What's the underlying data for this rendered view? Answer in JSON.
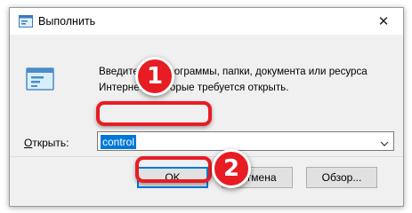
{
  "window": {
    "title": "Выполнить",
    "close_symbol": "✕",
    "app_icon": "run-dialog-icon"
  },
  "dialog": {
    "icon": "run-program-icon",
    "description_line1": "Введите имя программы, папки, документа или ресурса",
    "description_line2": "Интернета, которые требуется открыть.",
    "open_label_prefix": "О",
    "open_label_rest": "ткрыть:",
    "input_value": "control",
    "dropdown_icon": "chevron-down-icon"
  },
  "buttons": {
    "ok": "OK",
    "cancel": "Отмена",
    "browse": "Обзор..."
  },
  "annotations": {
    "step1": "1",
    "step2": "2",
    "highlight_color": "#e81c23"
  },
  "colors": {
    "selection": "#0078d7",
    "dialog_bg": "#f0f0f0"
  }
}
